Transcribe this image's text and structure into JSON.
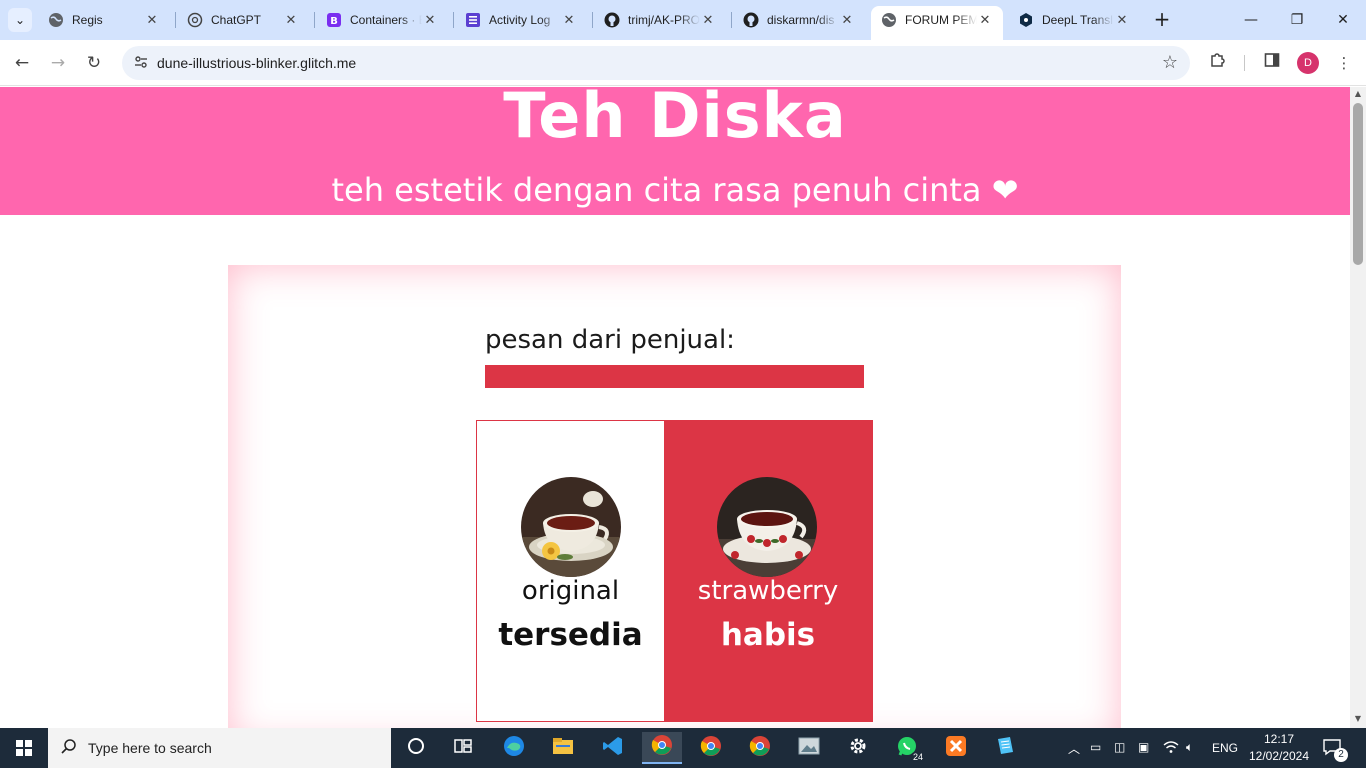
{
  "browser": {
    "tabs": [
      {
        "title": "Regis",
        "icon": "globe-icon",
        "active": false
      },
      {
        "title": "ChatGPT",
        "icon": "chatgpt-icon",
        "active": false
      },
      {
        "title": "Containers · Bootstrap",
        "icon": "bootstrap-icon",
        "active": false
      },
      {
        "title": "Activity Log",
        "icon": "list-icon",
        "active": false
      },
      {
        "title": "trimj/AK-PRO",
        "icon": "github-icon",
        "active": false
      },
      {
        "title": "diskarmn/dis",
        "icon": "github-icon",
        "active": false
      },
      {
        "title": "FORUM PEM",
        "icon": "globe-icon",
        "active": true
      },
      {
        "title": "DeepL Transl",
        "icon": "deepl-icon",
        "active": false
      }
    ],
    "url": "dune-illustrious-blinker.glitch.me",
    "profile_initial": "D"
  },
  "page": {
    "title": "Teh Diska",
    "tagline": "teh estetik dengan cita rasa penuh cinta ❤",
    "message_label": "pesan dari penjual:",
    "products": [
      {
        "name": "original",
        "status": "tersedia",
        "image": "tea-cup-flower-image"
      },
      {
        "name": "strawberry",
        "status": "habis",
        "image": "tea-cup-floral-image"
      }
    ],
    "colors": {
      "hero": "#ff66ae",
      "accent": "#dc3545"
    }
  },
  "taskbar": {
    "search_placeholder": "Type here to search",
    "whatsapp_badge": "24",
    "language": "ENG",
    "time": "12:17",
    "date": "12/02/2024",
    "notifications": "2"
  }
}
